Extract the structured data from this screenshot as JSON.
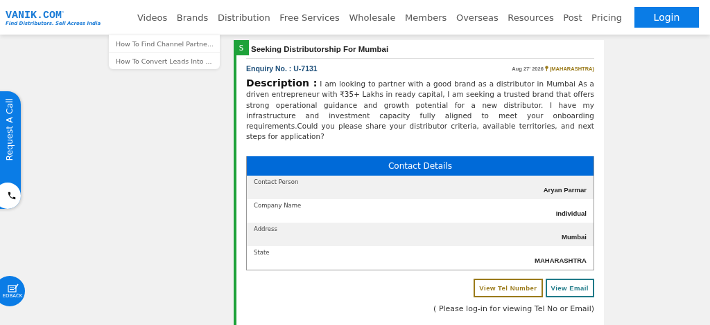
{
  "header": {
    "logo": {
      "name": "VANIK.COM",
      "tm": "™",
      "tagline": "Find Distributors. Sell Across India"
    },
    "nav": [
      {
        "label": "Videos"
      },
      {
        "label": "Brands"
      },
      {
        "label": "Distribution"
      },
      {
        "label": "Free Services"
      },
      {
        "label": "Wholesale"
      },
      {
        "label": "Members"
      },
      {
        "label": "Overseas"
      },
      {
        "label": "Resources"
      },
      {
        "label": "Post"
      },
      {
        "label": "Pricing"
      }
    ],
    "login": "Login"
  },
  "sidebar": {
    "items": [
      {
        "label": "How To Find Channel Partne..."
      },
      {
        "label": "How To Convert Leads Into ..."
      }
    ]
  },
  "request_call": "Request A Call",
  "feedback": "EDBACK",
  "enquiry": {
    "badge": "S",
    "title": "Seeking Distributorship For Mumbai",
    "number": "Enquiry No. : U-7131",
    "date": "Aug 27' 2026",
    "location": "(MAHARASHTRA)",
    "description_label": "Description :",
    "description": "I am looking to partner with a good brand as a distributor in Mumbai As a driven entrepreneur with ₹35+ Lakhs in ready capital, I am seeking a trusted brand that offers strong operational guidance and growth potential for a new distributor. I have my infrastructure and investment capacity fully aligned to meet your onboarding requirements.Could you please share your distributor criteria, available territories, and next steps for application?",
    "contact": {
      "title": "Contact Details",
      "rows": [
        {
          "label": "Contact Person",
          "value": "Aryan Parmar"
        },
        {
          "label": "Company Name",
          "value": "Individual"
        },
        {
          "label": "Address",
          "value": "Mumbai"
        },
        {
          "label": "State",
          "value": "MAHARASHTRA"
        }
      ]
    },
    "buttons": [
      {
        "kind": "tel",
        "label": "View Tel Number"
      },
      {
        "kind": "email",
        "label": "View Email"
      }
    ],
    "note": "( Please log-in for viewing Tel No or Email)"
  }
}
